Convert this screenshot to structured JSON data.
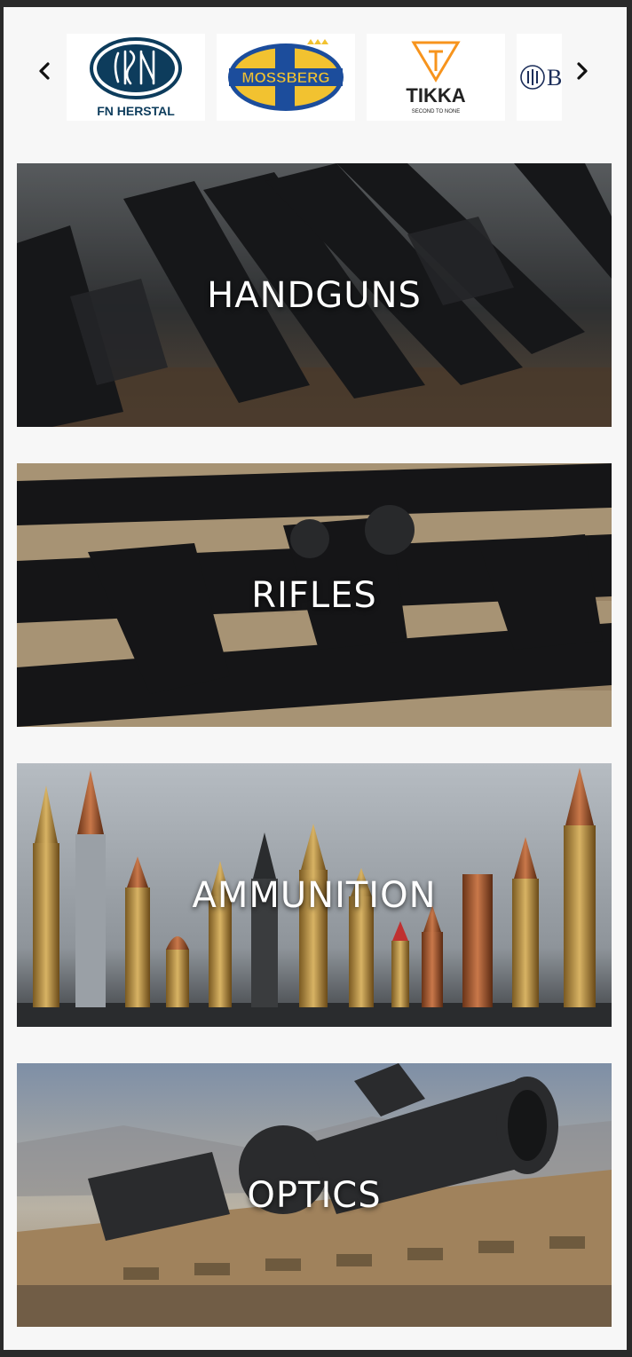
{
  "carousel": {
    "prev_icon": "chevron-left-icon",
    "next_icon": "chevron-right-icon",
    "brands": [
      {
        "name": "FN HERSTAL",
        "color": "#0d3c5c"
      },
      {
        "name": "MOSSBERG",
        "color": "#1c4d9c",
        "accent": "#f2c230"
      },
      {
        "name": "TIKKA",
        "tagline": "SECOND TO NONE",
        "color": "#222222",
        "accent": "#f7941d"
      },
      {
        "name": "B",
        "color": "#1c2e5a"
      }
    ]
  },
  "categories": [
    {
      "label": "HANDGUNS"
    },
    {
      "label": "RIFLES"
    },
    {
      "label": "AMMUNITION"
    },
    {
      "label": "OPTICS"
    }
  ]
}
